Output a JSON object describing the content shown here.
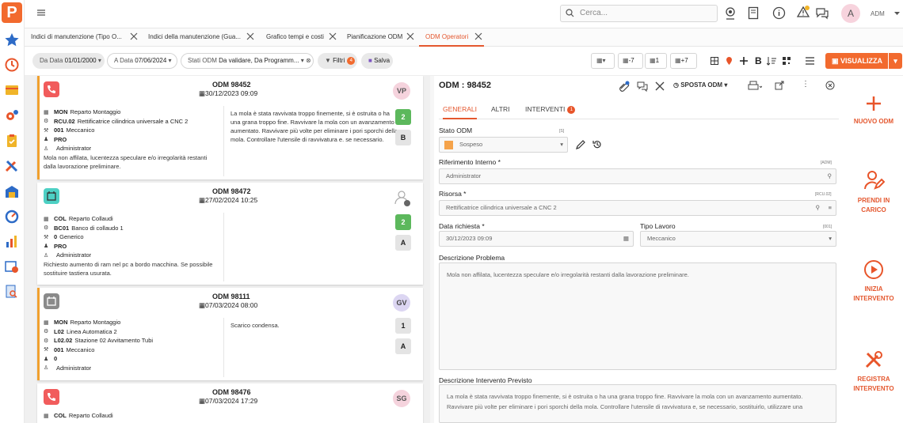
{
  "app": {
    "logo_letter": "P",
    "accent": "#f26a2e"
  },
  "sidebar_icons": [
    "star-icon",
    "clock-icon",
    "folder-icon",
    "gears-icon",
    "clipboard-icon",
    "tools-icon",
    "warehouse-icon",
    "gauge-icon",
    "bar-chart-icon",
    "calendar-clock-icon",
    "document-search-icon"
  ],
  "topbar": {
    "search_placeholder": "Cerca...",
    "avatar": "A",
    "user": "ADM"
  },
  "tabs": [
    {
      "label": "Indici di manutenzione (Tipo O..."
    },
    {
      "label": "Indici della manutenzione (Gua..."
    },
    {
      "label": "Grafico tempi e costi"
    },
    {
      "label": "Pianificazione ODM"
    },
    {
      "label": "ODM Operatori"
    }
  ],
  "filters": {
    "from_label": "Da Data",
    "from_value": "01/01/2000",
    "to_label": "A Data",
    "to_value": "07/06/2024",
    "state_label": "Stati ODM",
    "state_value": "Da validare, Da Programm...",
    "filters_btn": "Filtri",
    "filters_count": "4",
    "save_btn": "Salva",
    "nav_back7": "-7",
    "nav_1": "1",
    "nav_fwd7": "+7",
    "visualize": "VISUALIZZA"
  },
  "cards": [
    {
      "odm": "ODM 98452",
      "date": "30/12/2023 09:09",
      "avatar": "VP",
      "num": "2",
      "letter": "B",
      "rows": [
        [
          "MON",
          "Reparto Montaggio"
        ],
        [
          "RCU.02",
          "Rettificatrice cilindrica universale a CNC 2"
        ],
        [
          "001",
          "Meccanico"
        ],
        [
          "PRO",
          ""
        ],
        [
          "",
          "Administrator"
        ]
      ],
      "desc": "Mola non affilata, lucentezza speculare e/o irregolarità restanti dalla lavorazione preliminare.",
      "note": "La mola è stata ravvivata troppo finemente, si è ostruita o ha una grana troppo fine. Ravvivare la mola con un avanzamento aumentato. Ravvivare più volte per eliminare i pori sporchi della mola. Controllare l'utensile di ravvivatura e. se necessario."
    },
    {
      "odm": "ODM 98472",
      "date": "27/02/2024 10:25",
      "avatar": "",
      "num": "2",
      "letter": "A",
      "rows": [
        [
          "COL",
          "Reparto Collaudi"
        ],
        [
          "BC01",
          "Banco di collaudo 1"
        ],
        [
          "0",
          "Generico"
        ],
        [
          "PRO",
          ""
        ],
        [
          "",
          "Administrator"
        ]
      ],
      "desc": "Richiesto aumento di ram nel pc a bordo macchina. Se possibile sostituire tastiera usurata.",
      "note": ""
    },
    {
      "odm": "ODM 98111",
      "date": "07/03/2024 08:00",
      "avatar": "GV",
      "num": "1",
      "letter": "A",
      "rows": [
        [
          "MON",
          "Reparto Montaggio"
        ],
        [
          "L02",
          "Linea Automatica 2"
        ],
        [
          "L02.02",
          "Stazione 02 Avvitamento Tubi"
        ],
        [
          "001",
          "Meccanico"
        ],
        [
          "0",
          ""
        ],
        [
          "",
          "Administrator"
        ]
      ],
      "desc": "",
      "note": "Scarico condensa."
    },
    {
      "odm": "ODM 98476",
      "date": "07/03/2024 17:29",
      "avatar": "SG",
      "num": "",
      "letter": "",
      "rows": [
        [
          "COL",
          "Reparto Collaudi"
        ]
      ],
      "desc": "",
      "note": ""
    }
  ],
  "detail": {
    "title": "ODM : 98452",
    "move_btn": "SPOSTA ODM",
    "tabs": {
      "t1": "GENERALI",
      "t2": "ALTRI",
      "t3": "INTERVENTI",
      "t3_count": "1"
    },
    "stato_label": "Stato ODM",
    "stato_hint": "[S]",
    "stato_value": "Sospeso",
    "stato_color": "#f5a34a",
    "rif_label": "Riferimento Interno *",
    "rif_hint": "[ADM]",
    "rif_value": "Administrator",
    "risorsa_label": "Risorsa *",
    "risorsa_hint": "[RCU.02]",
    "risorsa_value": "Rettificatrice cilindrica universale a CNC 2",
    "data_label": "Data richiesta *",
    "data_value": "30/12/2023 09:09",
    "tipo_label": "Tipo Lavoro",
    "tipo_hint": "[001]",
    "tipo_value": "Meccanico",
    "problema_label": "Descrizione Problema",
    "problema_value": "Mola non affilata, lucentezza speculare e/o irregolarità restanti dalla lavorazione preliminare.",
    "intervento_label": "Descrizione Intervento Previsto",
    "intervento_value": "La mola è stata ravvivata troppo finemente, si è ostruita o ha una grana troppo fine. Ravvivare la mola con un avanzamento aumentato. Ravvivare più volte per eliminare i pori sporchi della mola. Controllare l'utensile di ravvivatura e, se necessario, sostituirlo, utilizzare una"
  },
  "actions": {
    "nuovo": "NUOVO ODM",
    "prendi1": "PRENDI IN",
    "prendi2": "CARICO",
    "inizia1": "INIZIA",
    "inizia2": "INTERVENTO",
    "registra1": "REGISTRA",
    "registra2": "INTERVENTO"
  }
}
